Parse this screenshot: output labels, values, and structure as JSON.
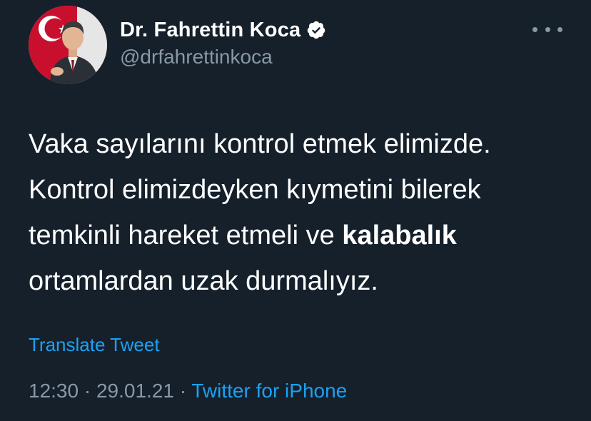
{
  "author": {
    "display_name": "Dr. Fahrettin Koca",
    "handle": "@drfahrettinkoca",
    "verified": true,
    "avatar_icon": "profile-photo-icon"
  },
  "tweet": {
    "line1": "Vaka sayılarını kontrol etmek elimizde.",
    "line2": "Kontrol elimizdeyken kıymetini bilerek",
    "line3_start": "temkinli hareket etmeli ve ",
    "line3_bold": "kalabalık",
    "line4": "ortamlardan uzak durmalıyız."
  },
  "translate_label": "Translate Tweet",
  "meta": {
    "time": "12:30",
    "separator": " · ",
    "date": "29.01.21",
    "source": "Twitter for iPhone"
  },
  "icons": {
    "verified": "verified-badge-icon",
    "more": "more-options-icon"
  },
  "colors": {
    "background": "#15202b",
    "text": "#ffffff",
    "secondary": "#8899a6",
    "link": "#1da1f2"
  }
}
